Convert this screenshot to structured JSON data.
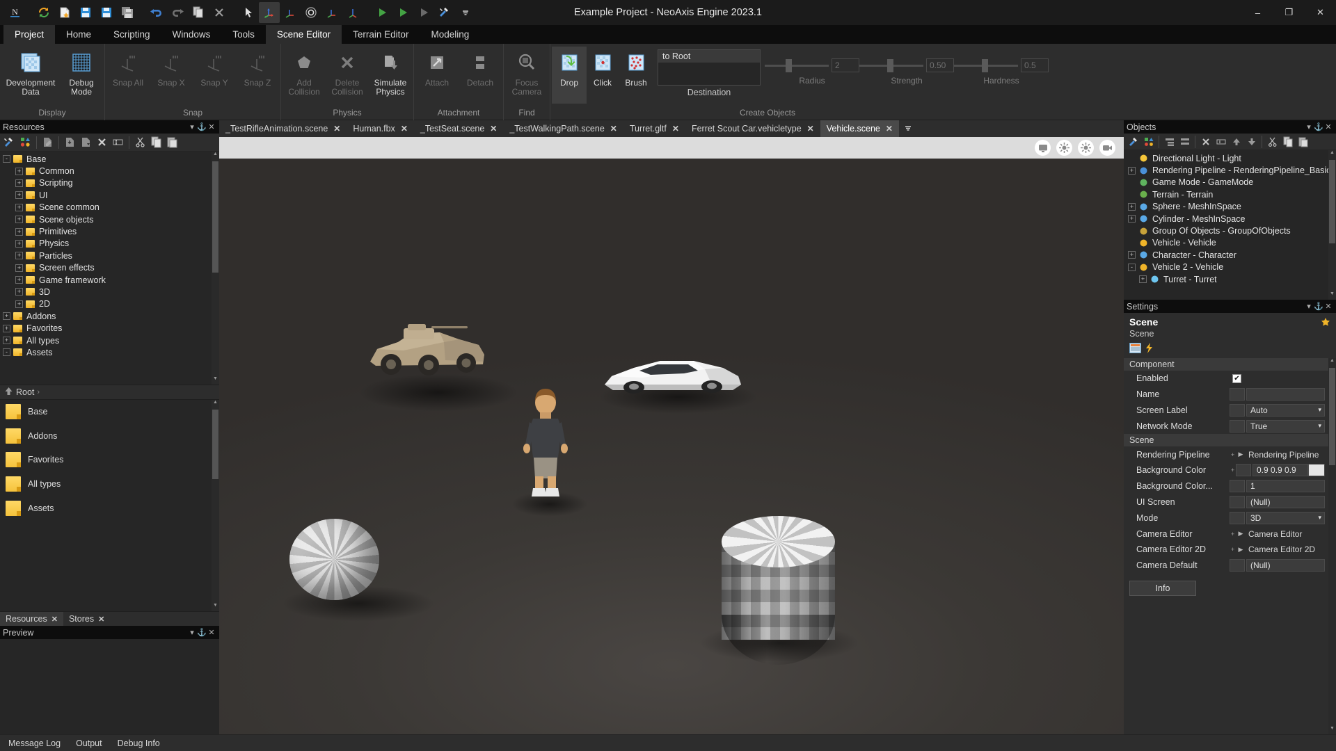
{
  "window": {
    "title": "Example Project - NeoAxis Engine 2023.1",
    "minimize": "–",
    "maximize": "❐",
    "close": "✕"
  },
  "quick_toolbar": [
    {
      "name": "neoaxis-logo-icon",
      "glyph": "N"
    },
    {
      "name": "restart-icon",
      "glyph": "↻"
    },
    {
      "name": "new-file-icon",
      "glyph": "⭐"
    },
    {
      "name": "save-icon",
      "glyph": "💾"
    },
    {
      "name": "save-as-icon",
      "glyph": "💾"
    },
    {
      "name": "save-all-icon",
      "glyph": "💾"
    },
    {
      "name": "undo-icon",
      "glyph": "↶"
    },
    {
      "name": "redo-icon",
      "glyph": "↷"
    },
    {
      "name": "copy-icon",
      "glyph": "❐"
    },
    {
      "name": "delete-icon",
      "glyph": "✕"
    },
    {
      "name": "select-tool-icon",
      "glyph": "↖"
    },
    {
      "name": "move-tool-icon",
      "glyph": "axis"
    },
    {
      "name": "rotate-tool-icon",
      "glyph": "axis"
    },
    {
      "name": "rotate-circle-icon",
      "glyph": "◎"
    },
    {
      "name": "scale-tool-icon",
      "glyph": "axis"
    },
    {
      "name": "transform-tool-icon",
      "glyph": "axis"
    },
    {
      "name": "play-icon",
      "glyph": "▶"
    },
    {
      "name": "play-simulation-icon",
      "glyph": "▶"
    },
    {
      "name": "play-disabled-icon",
      "glyph": "▶"
    },
    {
      "name": "options-icon",
      "glyph": "🔧"
    },
    {
      "name": "overflow-icon",
      "glyph": "≡"
    }
  ],
  "ribbon_tabs": [
    {
      "label": "Project",
      "selected": true
    },
    {
      "label": "Home",
      "selected": false
    },
    {
      "label": "Scripting",
      "selected": false
    },
    {
      "label": "Windows",
      "selected": false
    },
    {
      "label": "Tools",
      "selected": false
    },
    {
      "label": "Scene Editor",
      "selected": true
    },
    {
      "label": "Terrain Editor",
      "selected": false
    },
    {
      "label": "Modeling",
      "selected": false
    }
  ],
  "ribbon": {
    "groups": [
      {
        "label": "Display",
        "items": [
          {
            "label": "Development Data",
            "icon": "development-data-icon",
            "disabled": false,
            "selected": false
          },
          {
            "label": "Debug Mode",
            "icon": "debug-mode-icon",
            "disabled": false,
            "selected": false
          }
        ]
      },
      {
        "label": "Snap",
        "items": [
          {
            "label": "Snap All",
            "icon": "snap-all-icon",
            "disabled": true,
            "selected": false
          },
          {
            "label": "Snap X",
            "icon": "snap-x-icon",
            "disabled": true,
            "selected": false
          },
          {
            "label": "Snap Y",
            "icon": "snap-y-icon",
            "disabled": true,
            "selected": false
          },
          {
            "label": "Snap Z",
            "icon": "snap-z-icon",
            "disabled": true,
            "selected": false
          }
        ]
      },
      {
        "label": "Physics",
        "items": [
          {
            "label": "Add Collision",
            "icon": "add-collision-icon",
            "disabled": true,
            "selected": false
          },
          {
            "label": "Delete Collision",
            "icon": "delete-collision-icon",
            "disabled": true,
            "selected": false
          },
          {
            "label": "Simulate Physics",
            "icon": "simulate-physics-icon",
            "disabled": true,
            "selected": false
          }
        ]
      },
      {
        "label": "Attachment",
        "items": [
          {
            "label": "Attach",
            "icon": "attach-icon",
            "disabled": true,
            "selected": false
          },
          {
            "label": "Detach",
            "icon": "detach-icon",
            "disabled": true,
            "selected": false
          }
        ]
      },
      {
        "label": "Find",
        "items": [
          {
            "label": "Focus Camera",
            "icon": "focus-camera-icon",
            "disabled": true,
            "selected": false
          }
        ]
      }
    ],
    "create_objects": {
      "label": "Create Objects",
      "modes": [
        {
          "label": "Drop",
          "icon": "drop-icon",
          "selected": true
        },
        {
          "label": "Click",
          "icon": "click-icon",
          "selected": false
        },
        {
          "label": "Brush",
          "icon": "brush-icon",
          "selected": false
        }
      ],
      "destination_label": "Destination",
      "destination_value": "to Root",
      "sliders": [
        {
          "label": "Radius",
          "value": "2"
        },
        {
          "label": "Strength",
          "value": "0.50"
        },
        {
          "label": "Hardness",
          "value": "0.5"
        }
      ]
    }
  },
  "resources_panel": {
    "title": "Resources",
    "head_buttons": [
      "▾",
      "⚓",
      "✕"
    ],
    "toolbar_icons": [
      "options-icon",
      "new-type-icon",
      "edit-icon",
      "import-icon",
      "export-icon",
      "delete-icon",
      "rename-icon",
      "cut-icon",
      "copy-icon",
      "paste-icon"
    ],
    "tree": [
      {
        "label": "Base",
        "depth": 0,
        "expander": "-"
      },
      {
        "label": "Common",
        "depth": 1,
        "expander": "+"
      },
      {
        "label": "Scripting",
        "depth": 1,
        "expander": "+"
      },
      {
        "label": "UI",
        "depth": 1,
        "expander": "+"
      },
      {
        "label": "Scene common",
        "depth": 1,
        "expander": "+"
      },
      {
        "label": "Scene objects",
        "depth": 1,
        "expander": "+"
      },
      {
        "label": "Primitives",
        "depth": 1,
        "expander": "+"
      },
      {
        "label": "Physics",
        "depth": 1,
        "expander": "+"
      },
      {
        "label": "Particles",
        "depth": 1,
        "expander": "+"
      },
      {
        "label": "Screen effects",
        "depth": 1,
        "expander": "+"
      },
      {
        "label": "Game framework",
        "depth": 1,
        "expander": "+"
      },
      {
        "label": "3D",
        "depth": 1,
        "expander": "+"
      },
      {
        "label": "2D",
        "depth": 1,
        "expander": "+"
      },
      {
        "label": "Addons",
        "depth": 0,
        "expander": "+"
      },
      {
        "label": "Favorites",
        "depth": 0,
        "expander": "+"
      },
      {
        "label": "All types",
        "depth": 0,
        "expander": "+"
      },
      {
        "label": "Assets",
        "depth": 0,
        "expander": "-"
      }
    ],
    "breadcrumb": {
      "up_icon": "up-arrow-icon",
      "root": "Root",
      "chevron": "›"
    },
    "files": [
      "Base",
      "Addons",
      "Favorites",
      "All types",
      "Assets"
    ],
    "bottom_tabs": [
      {
        "label": "Resources",
        "selected": true
      },
      {
        "label": "Stores",
        "selected": false
      }
    ]
  },
  "preview_panel": {
    "title": "Preview",
    "head_buttons": [
      "▾",
      "⚓",
      "✕"
    ]
  },
  "document_tabs": [
    {
      "label": "_TestRifleAnimation.scene",
      "selected": false
    },
    {
      "label": "Human.fbx",
      "selected": false
    },
    {
      "label": "_TestSeat.scene",
      "selected": false
    },
    {
      "label": "_TestWalkingPath.scene",
      "selected": false
    },
    {
      "label": "Turret.gltf",
      "selected": false
    },
    {
      "label": "Ferret Scout Car.vehicletype",
      "selected": false
    },
    {
      "label": "Vehicle.scene",
      "selected": true
    }
  ],
  "viewport": {
    "toolbar_icons": [
      {
        "name": "display-mode-icon",
        "glyph": "🖥"
      },
      {
        "name": "lighting-icon",
        "glyph": "☀"
      },
      {
        "name": "brightness-icon",
        "glyph": "☀"
      },
      {
        "name": "camera-icon",
        "glyph": "📷"
      }
    ]
  },
  "objects_panel": {
    "title": "Objects",
    "head_buttons": [
      "▾",
      "⚓",
      "✕"
    ],
    "toolbar_icons": [
      "options-icon",
      "new-object-icon",
      "separator",
      "expand-icon",
      "collapse-icon",
      "separator",
      "delete-icon",
      "rename-icon",
      "move-up-icon",
      "move-down-icon",
      "separator",
      "cut-icon",
      "copy-icon",
      "paste-icon"
    ],
    "tree": [
      {
        "label": "Directional Light - Light",
        "depth": 1,
        "expander": "",
        "icon": "light-icon"
      },
      {
        "label": "Rendering Pipeline - RenderingPipeline_Basic",
        "depth": 1,
        "expander": "+",
        "icon": "pipeline-icon"
      },
      {
        "label": "Game Mode - GameMode",
        "depth": 1,
        "expander": "",
        "icon": "gamemode-icon"
      },
      {
        "label": "Terrain - Terrain",
        "depth": 1,
        "expander": "",
        "icon": "terrain-icon"
      },
      {
        "label": "Sphere - MeshInSpace",
        "depth": 1,
        "expander": "+",
        "icon": "mesh-icon"
      },
      {
        "label": "Cylinder - MeshInSpace",
        "depth": 1,
        "expander": "+",
        "icon": "mesh-icon"
      },
      {
        "label": "Group Of Objects - GroupOfObjects",
        "depth": 1,
        "expander": "",
        "icon": "group-icon"
      },
      {
        "label": "Vehicle - Vehicle",
        "depth": 1,
        "expander": "",
        "icon": "vehicle-icon"
      },
      {
        "label": "Character - Character",
        "depth": 1,
        "expander": "+",
        "icon": "character-icon"
      },
      {
        "label": "Vehicle 2 - Vehicle",
        "depth": 1,
        "expander": "-",
        "icon": "vehicle-icon"
      },
      {
        "label": "Turret - Turret",
        "depth": 2,
        "expander": "+",
        "icon": "turret-icon"
      }
    ]
  },
  "settings_panel": {
    "title": "Settings",
    "head_buttons": [
      "▾",
      "⚓",
      "✕"
    ],
    "object_name": "Scene",
    "object_type": "Scene",
    "star_icon": "star-icon",
    "tool_icons": [
      "properties-icon",
      "events-icon"
    ],
    "sections": [
      {
        "label": "Component",
        "rows": [
          {
            "name": "Enabled",
            "kind": "checkbox",
            "value": "✔"
          },
          {
            "name": "Name",
            "kind": "text",
            "value": ""
          },
          {
            "name": "Screen Label",
            "kind": "combo",
            "value": "Auto"
          },
          {
            "name": "Network Mode",
            "kind": "combo",
            "value": "True"
          }
        ]
      },
      {
        "label": "Scene",
        "rows": [
          {
            "name": "Rendering Pipeline",
            "kind": "ref",
            "value": "Rendering Pipeline"
          },
          {
            "name": "Background Color",
            "kind": "color",
            "value": "0.9 0.9 0.9",
            "swatch": "#e6e6e6"
          },
          {
            "name": "Background Color...",
            "kind": "text",
            "value": "1"
          },
          {
            "name": "UI Screen",
            "kind": "text",
            "value": "(Null)"
          },
          {
            "name": "Mode",
            "kind": "combo",
            "value": "3D"
          },
          {
            "name": "Camera Editor",
            "kind": "ref",
            "value": "Camera Editor"
          },
          {
            "name": "Camera Editor 2D",
            "kind": "ref",
            "value": "Camera Editor 2D"
          },
          {
            "name": "Camera Default",
            "kind": "text",
            "value": "(Null)"
          }
        ]
      }
    ],
    "info_button": "Info"
  },
  "status_bar": {
    "items": [
      "Message Log",
      "Output",
      "Debug Info"
    ]
  }
}
